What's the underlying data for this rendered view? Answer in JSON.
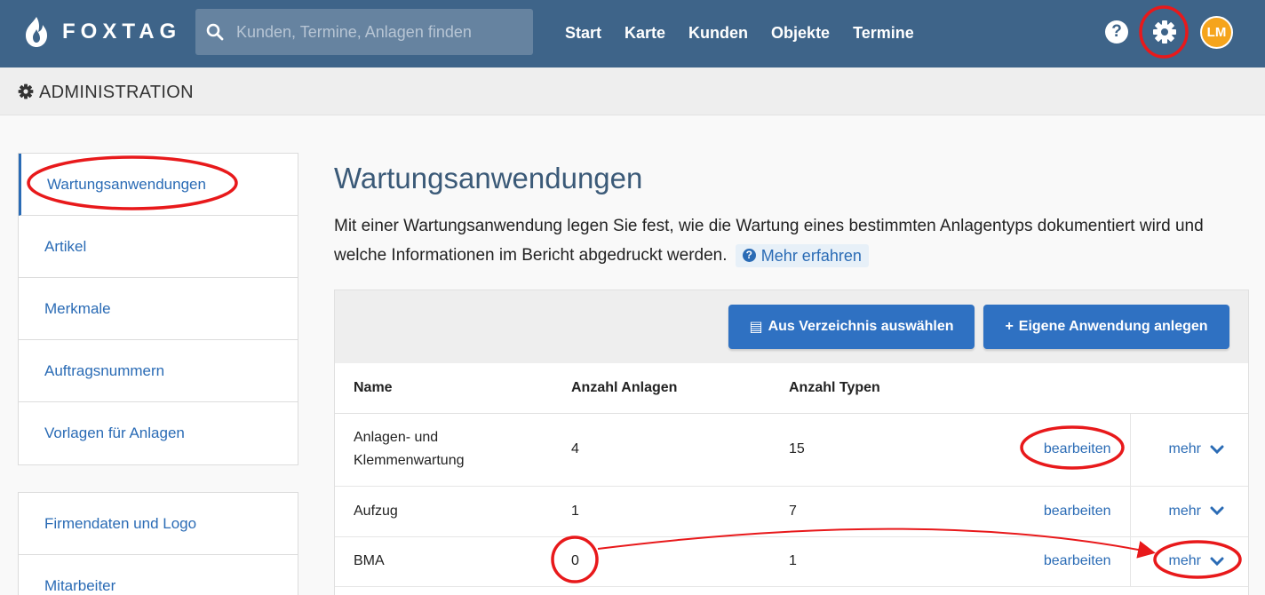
{
  "app": {
    "brand": "FOXTAG",
    "search_placeholder": "Kunden, Termine, Anlagen finden",
    "nav": [
      "Start",
      "Karte",
      "Kunden",
      "Objekte",
      "Termine"
    ],
    "help_label": "?",
    "avatar_initials": "LM"
  },
  "admin_bar": {
    "title": "ADMINISTRATION"
  },
  "sidebar": {
    "group1": [
      "Wartungsanwendungen",
      "Artikel",
      "Merkmale",
      "Auftragsnummern",
      "Vorlagen für Anlagen"
    ],
    "group2": [
      "Firmendaten und Logo",
      "Mitarbeiter"
    ]
  },
  "main": {
    "title": "Wartungsanwendungen",
    "description": "Mit einer Wartungsanwendung legen Sie fest, wie die Wartung eines bestimmten Anlagentyps dokumentiert wird und welche Informationen im Bericht abgedruckt werden.",
    "learn_more": "Mehr erfahren",
    "btn_directory": "Aus Verzeichnis auswählen",
    "btn_create": "Eigene Anwendung anlegen",
    "table": {
      "headers": [
        "Name",
        "Anzahl Anlagen",
        "Anzahl Typen"
      ],
      "rows": [
        {
          "name": "Anlagen- und Klemmenwartung",
          "anlagen": "4",
          "typen": "15",
          "edit": "bearbeiten",
          "more": "mehr"
        },
        {
          "name": "Aufzug",
          "anlagen": "1",
          "typen": "7",
          "edit": "bearbeiten",
          "more": "mehr"
        },
        {
          "name": "BMA",
          "anlagen": "0",
          "typen": "1",
          "edit": "bearbeiten",
          "more": "mehr"
        }
      ]
    }
  },
  "colors": {
    "navbar": "#3e6489",
    "accent": "#2a6bb5",
    "button": "#2f71c2",
    "avatar": "#f5a41c",
    "annotation": "#e8191b"
  }
}
